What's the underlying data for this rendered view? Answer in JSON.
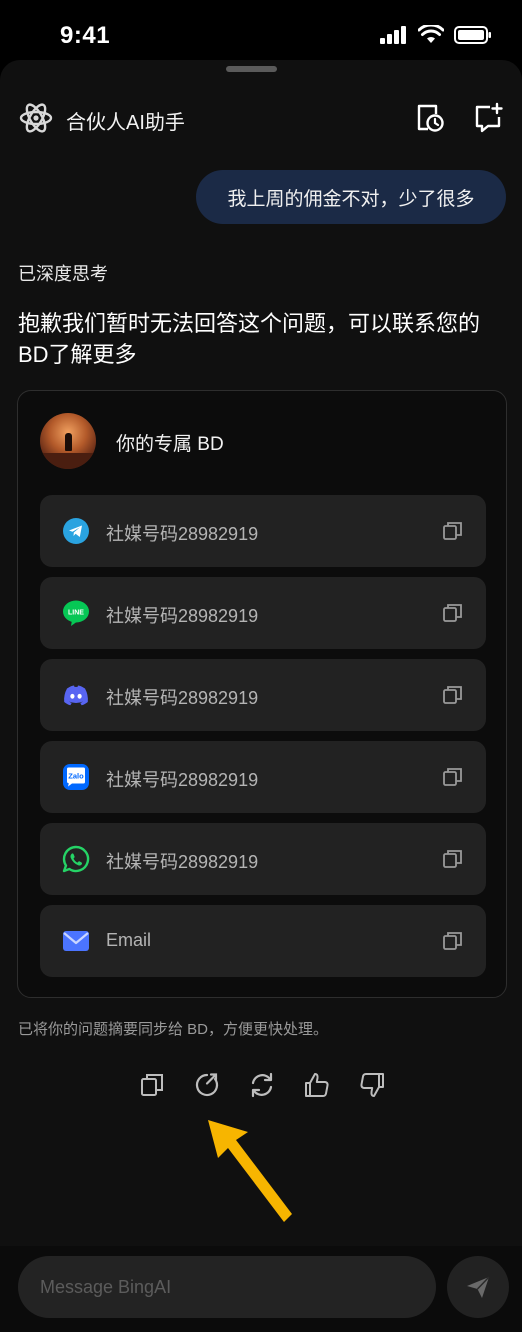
{
  "status_bar": {
    "time": "9:41"
  },
  "header": {
    "title": "合伙人AI助手",
    "logo_icon": "atom-icon"
  },
  "user_message": "我上周的佣金不对，少了很多",
  "assistant": {
    "thinking_label": "已深度思考",
    "answer": "抱歉我们暂时无法回答这个问题，可以联系您的BD了解更多"
  },
  "bd_card": {
    "title": "你的专属 BD",
    "contacts": [
      {
        "platform": "Telegram",
        "icon": "telegram-icon",
        "label": "社媒号码28982919"
      },
      {
        "platform": "LINE",
        "icon": "line-icon",
        "label": "社媒号码28982919"
      },
      {
        "platform": "Discord",
        "icon": "discord-icon",
        "label": "社媒号码28982919"
      },
      {
        "platform": "Zalo",
        "icon": "zalo-icon",
        "label": "社媒号码28982919"
      },
      {
        "platform": "WhatsApp",
        "icon": "whatsapp-icon",
        "label": "社媒号码28982919"
      },
      {
        "platform": "Email",
        "icon": "email-icon",
        "label": "Email"
      }
    ]
  },
  "sync_note": "已将你的问题摘要同步给 BD，方便更快处理。",
  "actions": [
    "copy-icon",
    "share-icon",
    "regenerate-icon",
    "thumbs-up-icon",
    "thumbs-down-icon"
  ],
  "composer": {
    "placeholder": "Message BingAI"
  },
  "colors": {
    "background": "#101010",
    "user_bubble": "#1b2a46",
    "card_row": "#222222",
    "annotation_arrow": "#f7b500"
  }
}
